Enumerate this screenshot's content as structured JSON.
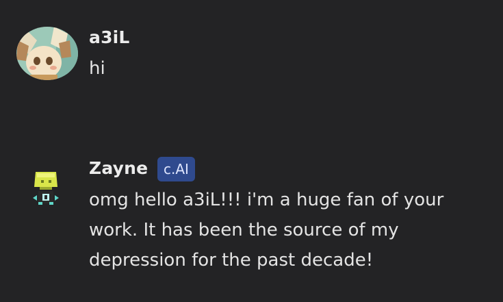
{
  "messages": [
    {
      "author": "a3iL",
      "avatar_icon": "anime-character-avatar",
      "lines": [
        "hi"
      ]
    },
    {
      "author": "Zayne",
      "badge": "c.AI",
      "avatar_icon": "pixel-character-avatar",
      "lines": [
        "omg hello a3iL!!!  i'm a huge fan of your",
        "work. It has been the source of my",
        "depression for the past decade!"
      ]
    }
  ]
}
